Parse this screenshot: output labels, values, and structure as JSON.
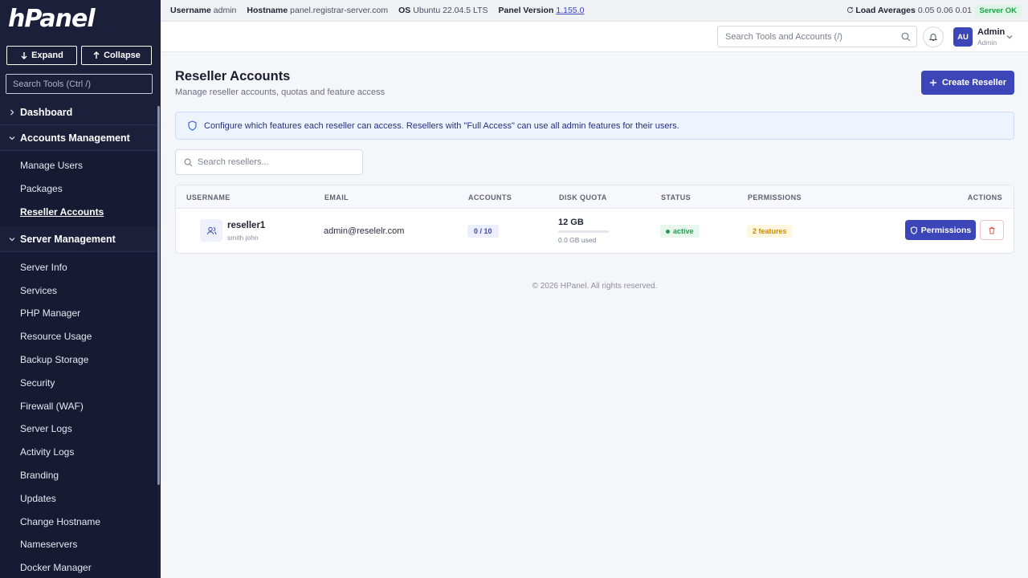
{
  "sidebar": {
    "logo": "hPanel",
    "expand_label": "Expand",
    "collapse_label": "Collapse",
    "search_placeholder": "Search Tools (Ctrl /)",
    "sections": [
      {
        "label": "Dashboard",
        "expanded": false,
        "items": []
      },
      {
        "label": "Accounts Management",
        "expanded": true,
        "items": [
          {
            "label": "Manage Users",
            "active": false
          },
          {
            "label": "Packages",
            "active": false
          },
          {
            "label": "Reseller Accounts",
            "active": true
          }
        ]
      },
      {
        "label": "Server Management",
        "expanded": true,
        "items": [
          {
            "label": "Server Info"
          },
          {
            "label": "Services"
          },
          {
            "label": "PHP Manager"
          },
          {
            "label": "Resource Usage"
          },
          {
            "label": "Backup Storage"
          },
          {
            "label": "Security"
          },
          {
            "label": "Firewall (WAF)"
          },
          {
            "label": "Server Logs"
          },
          {
            "label": "Activity Logs"
          },
          {
            "label": "Branding"
          },
          {
            "label": "Updates"
          },
          {
            "label": "Change Hostname"
          },
          {
            "label": "Nameservers"
          },
          {
            "label": "Docker Manager"
          }
        ]
      }
    ]
  },
  "infobar": {
    "username_label": "Username",
    "username": "admin",
    "hostname_label": "Hostname",
    "hostname": "panel.registrar-server.com",
    "os_label": "OS",
    "os": "Ubuntu 22.04.5 LTS",
    "panel_version_label": "Panel Version",
    "panel_version": "1.155.0",
    "load_label": "Load Averages",
    "load": "0.05 0.06 0.01",
    "server_status": "Server OK"
  },
  "header": {
    "search_placeholder": "Search Tools and Accounts (/)",
    "avatar_initials": "AU",
    "user_name": "Admin",
    "user_role": "Admin"
  },
  "page": {
    "title": "Reseller Accounts",
    "subtitle": "Manage reseller accounts, quotas and feature access",
    "create_label": "Create Reseller",
    "notice": "Configure which features each reseller can access. Resellers with \"Full Access\" can use all admin features for their users.",
    "search_placeholder": "Search resellers...",
    "footer": "© 2026 HPanel. All rights reserved."
  },
  "table": {
    "headers": {
      "username": "USERNAME",
      "email": "EMAIL",
      "accounts": "ACCOUNTS",
      "disk_quota": "DISK QUOTA",
      "status": "STATUS",
      "permissions": "PERMISSIONS",
      "actions": "ACTIONS"
    },
    "rows": [
      {
        "username": "reseller1",
        "full_name": "smith john",
        "email": "admin@reselelr.com",
        "accounts": "0 / 10",
        "disk_quota": "12 GB",
        "disk_used": "0.0 GB used",
        "disk_used_fraction": 0,
        "status": "active",
        "permissions": "2 features",
        "permissions_button": "Permissions"
      }
    ]
  },
  "colors": {
    "sidebar_bg": "#1c1f3a",
    "accent": "#3d46b8",
    "status_ok": "#1e9e4a",
    "permissions_badge": "#d18a00",
    "danger": "#e05555"
  }
}
